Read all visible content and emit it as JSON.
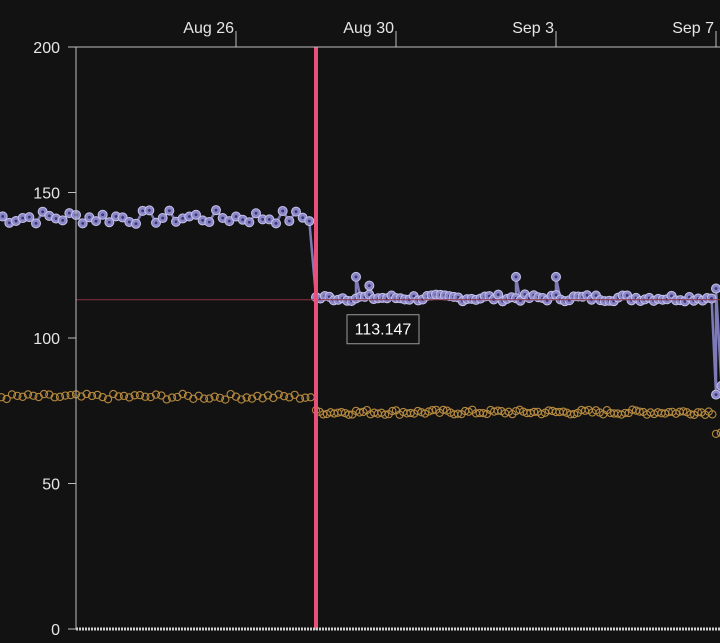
{
  "chart_data": {
    "type": "scatter",
    "x_type": "date",
    "y_ticks": [
      0,
      50,
      100,
      150,
      200
    ],
    "ylim": [
      0,
      200
    ],
    "xlim": [
      "2023-08-20",
      "2023-09-10"
    ],
    "x_ticks": [
      {
        "date": "2023-08-26",
        "label": "Aug 26"
      },
      {
        "date": "2023-08-30",
        "label": "Aug 30"
      },
      {
        "date": "2023-09-03",
        "label": "Sep 3"
      },
      {
        "date": "2023-09-07",
        "label": "Sep 7"
      }
    ],
    "cursor_date": "2023-08-28",
    "hover_value": 113.147,
    "hover_label": "113.147",
    "series": [
      {
        "color": "#8a86c8",
        "marker": "dot",
        "connected": true,
        "segments": [
          {
            "start": "2023-08-20",
            "end": "2023-08-28",
            "base": 141.5,
            "spread": 2.5,
            "points": 48
          },
          {
            "start": "2023-08-28",
            "end": "2023-09-07",
            "base": 113.8,
            "spread": 1.2,
            "points": 90
          },
          {
            "start": "2023-09-07",
            "end": "2023-09-10",
            "base": 82.5,
            "spread": 2.0,
            "points": 22
          }
        ],
        "spikes": [
          {
            "date": "2023-08-29",
            "value": 121
          },
          {
            "date": "2023-08-29T08:00",
            "value": 118
          },
          {
            "date": "2023-09-02",
            "value": 121
          },
          {
            "date": "2023-09-03",
            "value": 121
          },
          {
            "date": "2023-09-07",
            "value": 117
          }
        ]
      },
      {
        "color": "#b5893f",
        "marker": "ring",
        "connected": false,
        "segments": [
          {
            "start": "2023-08-20",
            "end": "2023-08-28",
            "base": 79.8,
            "spread": 1.0,
            "points": 60
          },
          {
            "start": "2023-08-28",
            "end": "2023-09-07",
            "base": 74.5,
            "spread": 0.9,
            "points": 110
          },
          {
            "start": "2023-09-07",
            "end": "2023-09-10",
            "base": 67.8,
            "spread": 0.9,
            "points": 25
          }
        ]
      }
    ],
    "colors": {
      "background": "#121212",
      "axis": "#bdbdbd",
      "cursor": "#e8507a",
      "hover_line": "#8b3043",
      "tooltip_border": "#9a9a9a"
    }
  }
}
